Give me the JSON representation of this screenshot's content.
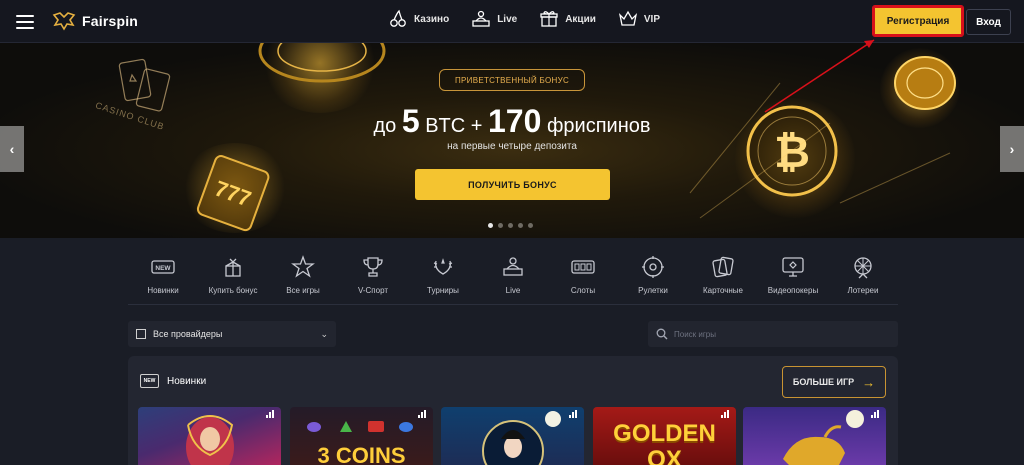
{
  "brand": {
    "name": "Fairspin"
  },
  "nav": [
    {
      "label": "Казино",
      "icon": "cherries-icon"
    },
    {
      "label": "Live",
      "icon": "live-dealer-icon"
    },
    {
      "label": "Акции",
      "icon": "gift-icon"
    },
    {
      "label": "VIP",
      "icon": "crown-icon"
    }
  ],
  "auth": {
    "register_label": "Регистрация",
    "login_label": "Вход"
  },
  "banner": {
    "tag": "ПРИВЕТСТВЕННЫЙ БОНУС",
    "title_prefix": "до ",
    "title_num1": "5",
    "title_mid": " BTC + ",
    "title_num2": "170",
    "title_suffix": " фриспинов",
    "subtitle": "на первые четыре депозита",
    "cta": "ПОЛУЧИТЬ БОНУС",
    "decor_text": "CASINO CLUB",
    "active_slide": 1,
    "slide_count": 5
  },
  "categories": [
    {
      "label": "Новинки",
      "icon": "new-badge-icon"
    },
    {
      "label": "Купить бонус",
      "icon": "bonus-box-icon"
    },
    {
      "label": "Все игры",
      "icon": "stars-icon"
    },
    {
      "label": "V-Спорт",
      "icon": "trophy-icon"
    },
    {
      "label": "Турниры",
      "icon": "wreath-icon"
    },
    {
      "label": "Live",
      "icon": "live-dealer-icon"
    },
    {
      "label": "Слоты",
      "icon": "slot-machine-icon"
    },
    {
      "label": "Рулетки",
      "icon": "roulette-icon"
    },
    {
      "label": "Карточные",
      "icon": "cards-icon"
    },
    {
      "label": "Видеопокеры",
      "icon": "video-poker-icon"
    },
    {
      "label": "Лотереи",
      "icon": "lottery-wheel-icon"
    }
  ],
  "filters": {
    "provider_value": "Все провайдеры",
    "search_placeholder": "Поиск игры"
  },
  "new_section": {
    "badge": "NEW",
    "title": "Новинки",
    "more_label": "БОЛЬШЕ ИГР"
  },
  "games": [
    {
      "title": "",
      "theme": "fortune-teller"
    },
    {
      "title": "3 COINS",
      "theme": "coins"
    },
    {
      "title": "",
      "theme": "geisha"
    },
    {
      "title": "GOLDEN OX",
      "theme": "ox"
    },
    {
      "title": "",
      "theme": "bull-night"
    }
  ],
  "colors": {
    "accent": "#f4c430",
    "highlight_border": "#d8101a",
    "background": "#1a1d26",
    "topbar": "#15171f"
  }
}
